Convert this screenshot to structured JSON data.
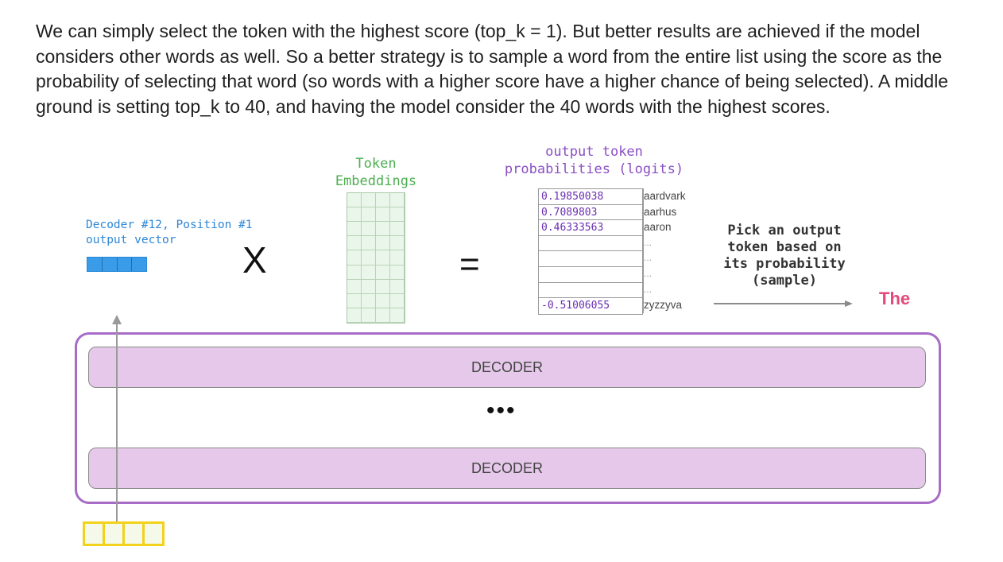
{
  "paragraph": "We can simply select the token with the highest score (top_k = 1). But better results are achieved if the model considers other words as well. So a better strategy is to sample a word from the entire list using the score as the probability of selecting that word (so words with a higher score have a higher chance of being selected). A middle ground is setting top_k to 40, and having the model consider the 40 words with the highest scores.",
  "labels": {
    "decoder_vector_line1": "Decoder #12, Position #1",
    "decoder_vector_line2": "output vector",
    "multiply": "X",
    "equals": "=",
    "embeddings_line1": "Token",
    "embeddings_line2": "Embeddings",
    "logits_line1": "output token",
    "logits_line2": "probabilities (logits)",
    "pick_line1": "Pick an output",
    "pick_line2": "token based on",
    "pick_line3": "its probability",
    "pick_line4": "(sample)",
    "output_word": "The",
    "decoder_top": "DECODER",
    "decoder_bottom": "DECODER",
    "ellipsis": "•••"
  },
  "logits": [
    {
      "value": "0.19850038",
      "word": "aardvark"
    },
    {
      "value": "0.7089803",
      "word": "aarhus"
    },
    {
      "value": "0.46333563",
      "word": "aaron"
    },
    {
      "value": "",
      "word": "..."
    },
    {
      "value": "",
      "word": "..."
    },
    {
      "value": "",
      "word": "..."
    },
    {
      "value": "",
      "word": "..."
    },
    {
      "value": "-0.51006055",
      "word": "zyzzyva"
    }
  ],
  "colors": {
    "decoder_vector": "#3a9be8",
    "embeddings": "#4caf50",
    "logits": "#8a4fc5",
    "output_word": "#e14a7b",
    "decoder_stack_border": "#a76cc6",
    "decoder_fill": "#e6c9ea",
    "input_vector_border": "#f2d21b"
  }
}
